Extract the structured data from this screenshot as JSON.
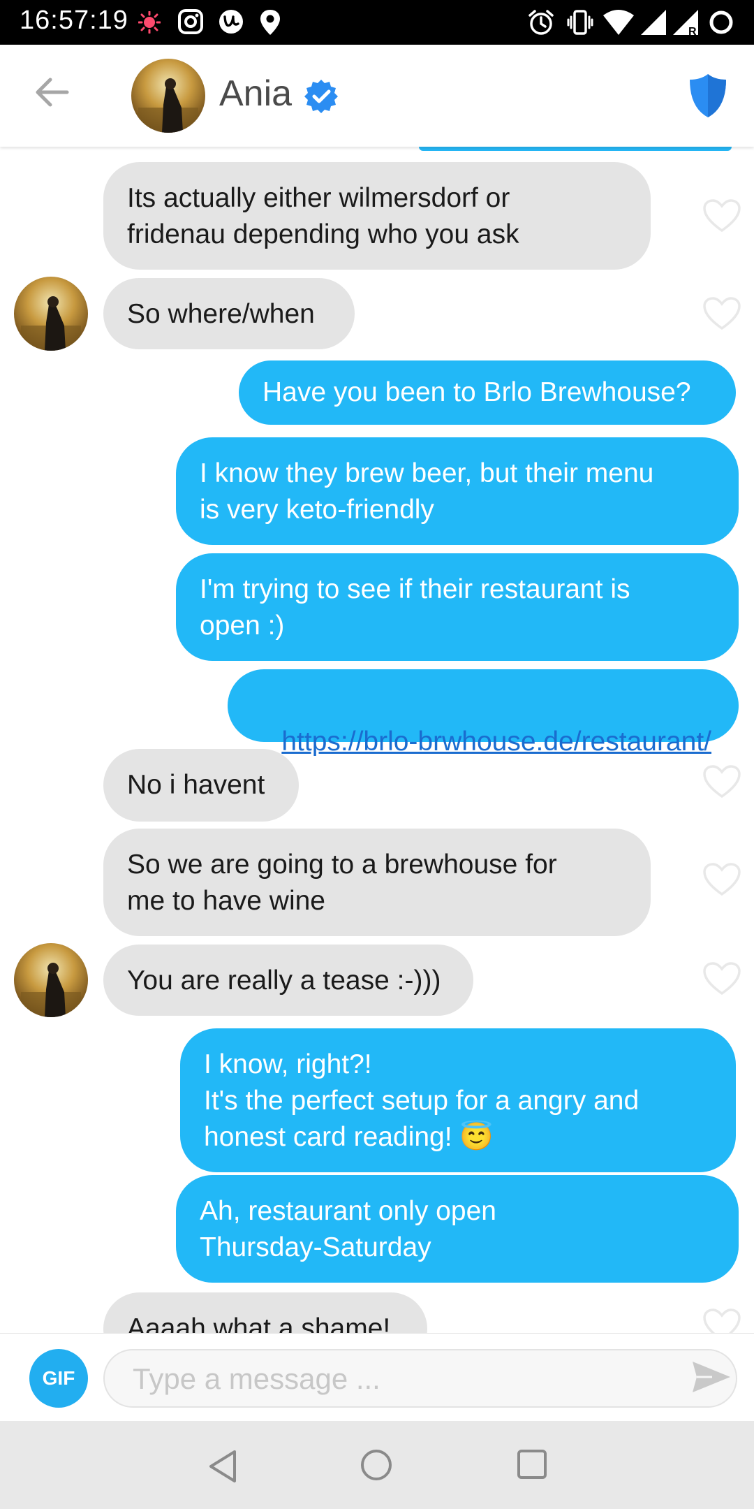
{
  "status_bar": {
    "time": "16:57:19",
    "icons": [
      "notification-dot-icon",
      "instagram-icon",
      "u-app-icon",
      "location-pin-icon",
      "alarm-icon",
      "vibrate-icon",
      "wifi-icon",
      "signal-icon",
      "signal-roaming-icon",
      "battery-circle-icon"
    ]
  },
  "header": {
    "back_icon": "back-arrow-icon",
    "name": "Ania",
    "verified_icon": "verified-badge-icon",
    "safety_icon": "shield-icon"
  },
  "messages": [
    {
      "side": "received",
      "text": "Its actually either wilmersdorf or\nfridenau depending who you ask",
      "avatar": false
    },
    {
      "side": "received",
      "text": "So where/when",
      "avatar": true
    },
    {
      "side": "sent",
      "text": "Have you been to Brlo Brewhouse?"
    },
    {
      "side": "sent",
      "text": "I know they brew beer, but their menu\nis very keto-friendly"
    },
    {
      "side": "sent",
      "text": "I'm trying to see if their restaurant is\nopen :)"
    },
    {
      "side": "sent",
      "text": "https://brlo-brwhouse.de/restaurant/",
      "link": true
    },
    {
      "side": "received",
      "text": "No i havent",
      "avatar": false
    },
    {
      "side": "received",
      "text": "So we are going to a brewhouse for\nme to have wine",
      "avatar": false
    },
    {
      "side": "received",
      "text": "You are really a tease :-)))",
      "avatar": true
    },
    {
      "side": "sent",
      "text": "I know, right?!\nIt's the perfect setup for a angry and\nhonest card reading! 😇"
    },
    {
      "side": "sent",
      "text": "Ah, restaurant only open\nThursday-Saturday"
    },
    {
      "side": "received",
      "text": "Aaaah what a shame!",
      "avatar": false
    }
  ],
  "composer": {
    "gif_label": "GIF",
    "placeholder": "Type a message ...",
    "send_icon": "send-icon"
  },
  "nav_bar": {
    "icons": [
      "nav-back-icon",
      "nav-home-icon",
      "nav-recents-icon"
    ]
  },
  "colors": {
    "sent_bubble": "#22b8f7",
    "received_bubble": "#e4e4e4",
    "verified": "#2b8df2",
    "gif_button": "#22aef0"
  }
}
